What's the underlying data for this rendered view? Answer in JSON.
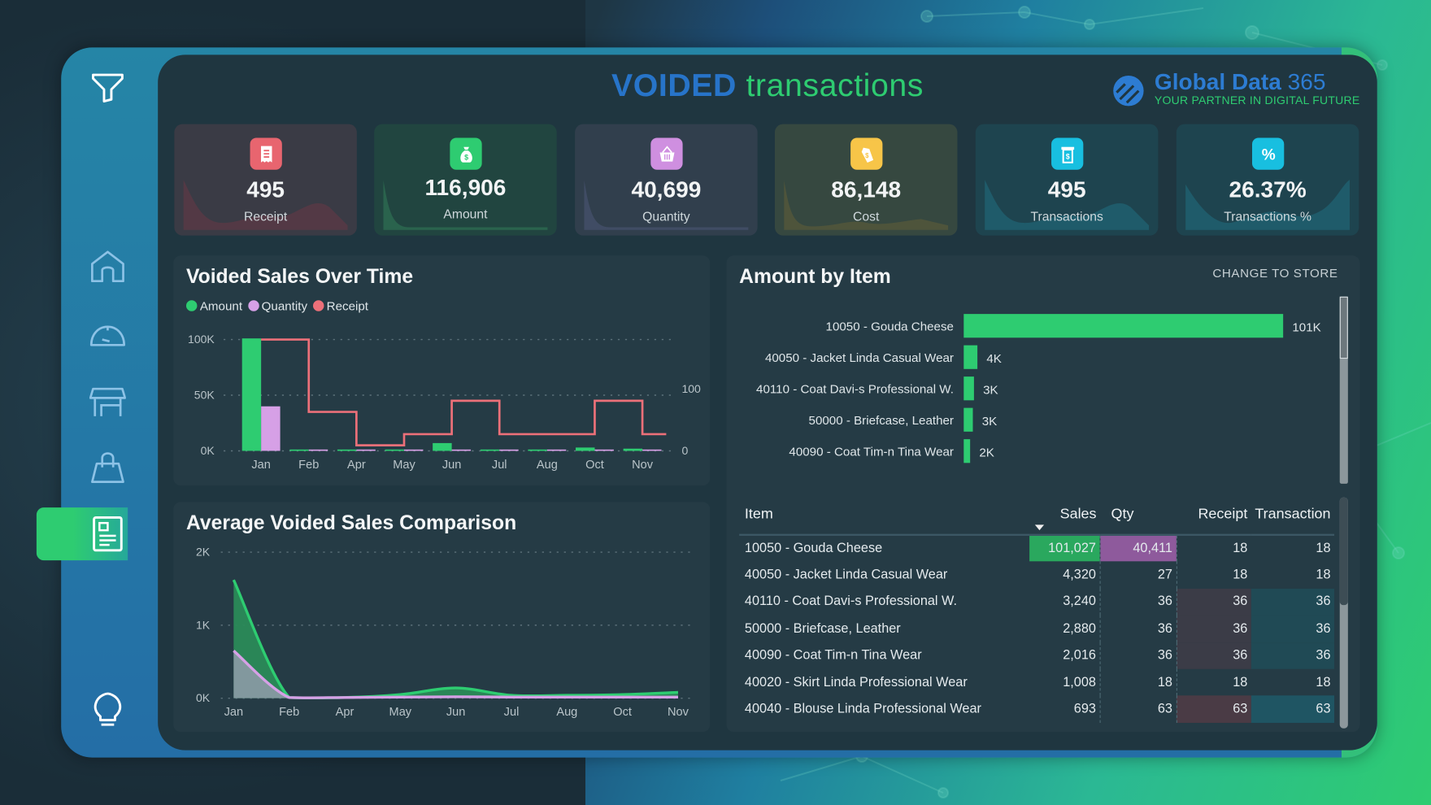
{
  "header": {
    "title_part1": "VOIDED",
    "title_part2": "transactions",
    "logo_name": "Global Data",
    "logo_number": "365",
    "logo_tagline": "YOUR PARTNER IN DIGITAL FUTURE"
  },
  "sidebar": {
    "top_icon": "filter-icon",
    "items": [
      {
        "icon": "home-icon",
        "active": false
      },
      {
        "icon": "speedometer-icon",
        "active": false
      },
      {
        "icon": "store-icon",
        "active": false
      },
      {
        "icon": "shopping-bag-icon",
        "active": false
      },
      {
        "icon": "report-icon",
        "active": true
      }
    ],
    "bottom_icon": "lightbulb-icon"
  },
  "kpis": [
    {
      "value": "495",
      "label": "Receipt",
      "icon": "receipt-icon",
      "color": "#e8656f"
    },
    {
      "value": "116,906",
      "label": "Amount",
      "icon": "money-bag-icon",
      "color": "#2ecc71"
    },
    {
      "value": "40,699",
      "label": "Quantity",
      "icon": "basket-icon",
      "color": "#cf8fe0"
    },
    {
      "value": "86,148",
      "label": "Cost",
      "icon": "price-tag-icon",
      "color": "#f7c548"
    },
    {
      "value": "495",
      "label": "Transactions",
      "icon": "receipt-dollar-icon",
      "color": "#18bfe0"
    },
    {
      "value": "26.37%",
      "label": "Transactions %",
      "icon": "percent-icon",
      "color": "#18bfe0"
    }
  ],
  "colors": {
    "amount": "#2ecc71",
    "quantity": "#d6a0e6",
    "receipt": "#ec7079",
    "brand_blue": "#2774c9",
    "brand_green": "#2ecc71"
  },
  "chart_data": [
    {
      "type": "bar",
      "title": "Voided Sales Over Time",
      "legend": [
        "Amount",
        "Quantity",
        "Receipt"
      ],
      "legend_position": "top-left",
      "categories": [
        "Jan",
        "Feb",
        "Apr",
        "May",
        "Jun",
        "Jul",
        "Aug",
        "Oct",
        "Nov"
      ],
      "series": [
        {
          "name": "Amount",
          "kind": "bar",
          "axis": "left",
          "values": [
            101000,
            0,
            0,
            500,
            7000,
            400,
            400,
            3000,
            2000
          ]
        },
        {
          "name": "Quantity",
          "kind": "bar",
          "axis": "left",
          "values": [
            40000,
            0,
            0,
            300,
            500,
            300,
            300,
            400,
            300
          ]
        },
        {
          "name": "Receipt",
          "kind": "step-line",
          "axis": "right",
          "values": [
            180,
            63,
            9,
            27,
            81,
            27,
            27,
            81,
            27
          ]
        }
      ],
      "y_ticks_left": [
        "0K",
        "50K",
        "100K"
      ],
      "ylim_left": [
        0,
        100000
      ],
      "y_ticks_right": [
        "0",
        "100"
      ],
      "ylim_right": [
        0,
        180
      ],
      "grid": true
    },
    {
      "type": "area",
      "title": "Average Voided Sales Comparison",
      "categories": [
        "Jan",
        "Feb",
        "Apr",
        "May",
        "Jun",
        "Jul",
        "Aug",
        "Oct",
        "Nov"
      ],
      "series": [
        {
          "name": "Amount",
          "values": [
            1620,
            10,
            10,
            50,
            140,
            40,
            40,
            50,
            80
          ]
        },
        {
          "name": "Quantity",
          "values": [
            650,
            10,
            10,
            15,
            20,
            15,
            15,
            15,
            15
          ]
        }
      ],
      "y_ticks": [
        "0K",
        "1K",
        "2K"
      ],
      "ylim": [
        0,
        2000
      ],
      "grid": true
    },
    {
      "type": "bar",
      "orientation": "horizontal",
      "title": "Amount by Item",
      "categories": [
        "10050 - Gouda Cheese",
        "40050 - Jacket Linda Casual Wear",
        "40110 - Coat Davi-s Professional W.",
        "50000 - Briefcase, Leather",
        "40090 - Coat Tim-n Tina Wear"
      ],
      "values": [
        101027,
        4320,
        3240,
        2880,
        2016
      ],
      "data_labels": [
        "101K",
        "4K",
        "3K",
        "3K",
        "2K"
      ],
      "xlim": [
        0,
        101027
      ]
    }
  ],
  "amount_by_item": {
    "change_link": "CHANGE TO STORE"
  },
  "table": {
    "columns": [
      "Item",
      "Sales",
      "Qty",
      "Receipt",
      "Transaction"
    ],
    "sort_column": "Sales",
    "sort_direction": "descending",
    "rows": [
      {
        "item": "10050 - Gouda Cheese",
        "sales": "101,027",
        "qty": "40,411",
        "receipt": "18",
        "transaction": "18"
      },
      {
        "item": "40050 - Jacket Linda Casual Wear",
        "sales": "4,320",
        "qty": "27",
        "receipt": "18",
        "transaction": "18"
      },
      {
        "item": "40110 - Coat Davi-s Professional W.",
        "sales": "3,240",
        "qty": "36",
        "receipt": "36",
        "transaction": "36"
      },
      {
        "item": "50000 - Briefcase, Leather",
        "sales": "2,880",
        "qty": "36",
        "receipt": "36",
        "transaction": "36"
      },
      {
        "item": "40090 - Coat Tim-n Tina Wear",
        "sales": "2,016",
        "qty": "36",
        "receipt": "36",
        "transaction": "36"
      },
      {
        "item": "40020 - Skirt Linda Professional Wear",
        "sales": "1,008",
        "qty": "18",
        "receipt": "18",
        "transaction": "18"
      },
      {
        "item": "40040 - Blouse Linda Professional Wear",
        "sales": "693",
        "qty": "63",
        "receipt": "63",
        "transaction": "63"
      }
    ]
  }
}
